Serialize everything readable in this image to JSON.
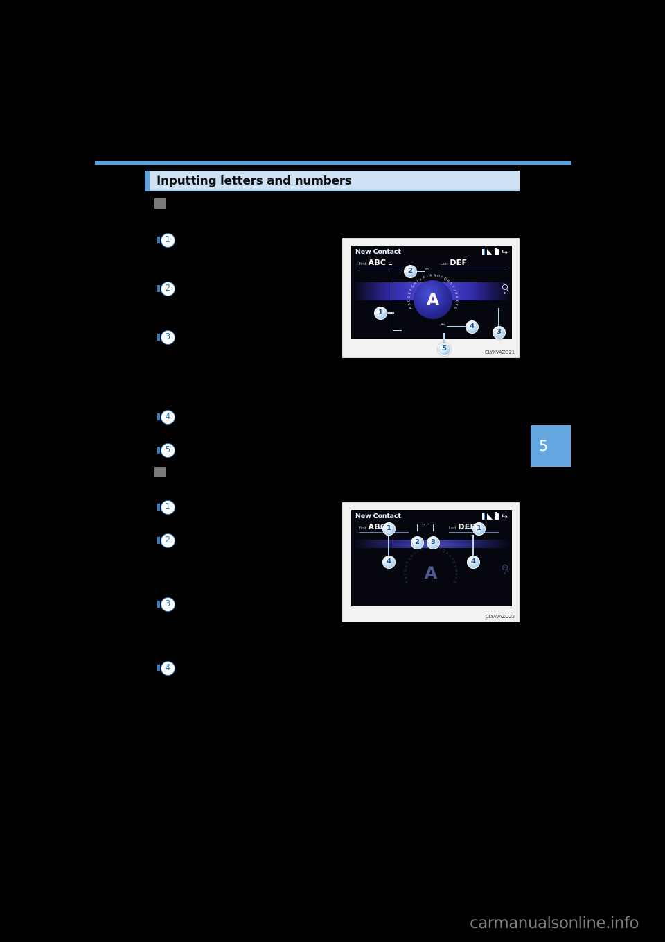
{
  "page": {
    "chapter_tab": "5",
    "watermark": "carmanualsonline.info"
  },
  "section": {
    "title": "Inputting letters and numbers"
  },
  "callouts_group_1": [
    "1",
    "2",
    "3",
    "4",
    "5"
  ],
  "callouts_group_2": [
    "1",
    "2",
    "3",
    "4"
  ],
  "figures": [
    {
      "code": "CLYXVAZO21",
      "screen": {
        "title": "New Contact",
        "fields": [
          {
            "label": "First",
            "value": "ABC"
          },
          {
            "label": "Last",
            "value": "DEF"
          }
        ],
        "dial_letter": "A",
        "dial_ring": [
          "A",
          "B",
          "C",
          "D",
          "E",
          "F",
          "G",
          "H",
          "I",
          "J",
          "K",
          "L",
          "M",
          "N",
          "O",
          "P",
          "Q",
          "R",
          "S",
          "T",
          "U",
          "V",
          "W",
          "X",
          "Y",
          "Z"
        ],
        "status_icons": [
          "bluetooth-icon",
          "signal-icon",
          "battery-icon",
          "back-icon"
        ],
        "right_controls": [
          "search-icon",
          "chevron-right-icon"
        ]
      },
      "bubbles": [
        "1",
        "2",
        "3",
        "4",
        "5"
      ]
    },
    {
      "code": "CLYAVAZO22",
      "screen": {
        "title": "New Contact",
        "fields": [
          {
            "label": "First",
            "value": "ABC"
          },
          {
            "label": "Last",
            "value": "DEF"
          }
        ],
        "dial_letter": "A",
        "dial_ring": [
          "A",
          "B",
          "C",
          "D",
          "E",
          "F",
          "G",
          "H",
          "I",
          "J",
          "K",
          "L",
          "M",
          "N",
          "O",
          "P",
          "Q",
          "R",
          "S",
          "T",
          "U",
          "V",
          "W",
          "X",
          "Y",
          "Z"
        ],
        "status_icons": [
          "bluetooth-icon",
          "signal-icon",
          "battery-icon",
          "back-icon"
        ],
        "right_controls": [
          "search-icon",
          "chevron-right-icon"
        ]
      },
      "bubbles": [
        "1",
        "1",
        "2",
        "3",
        "4",
        "4"
      ]
    }
  ]
}
